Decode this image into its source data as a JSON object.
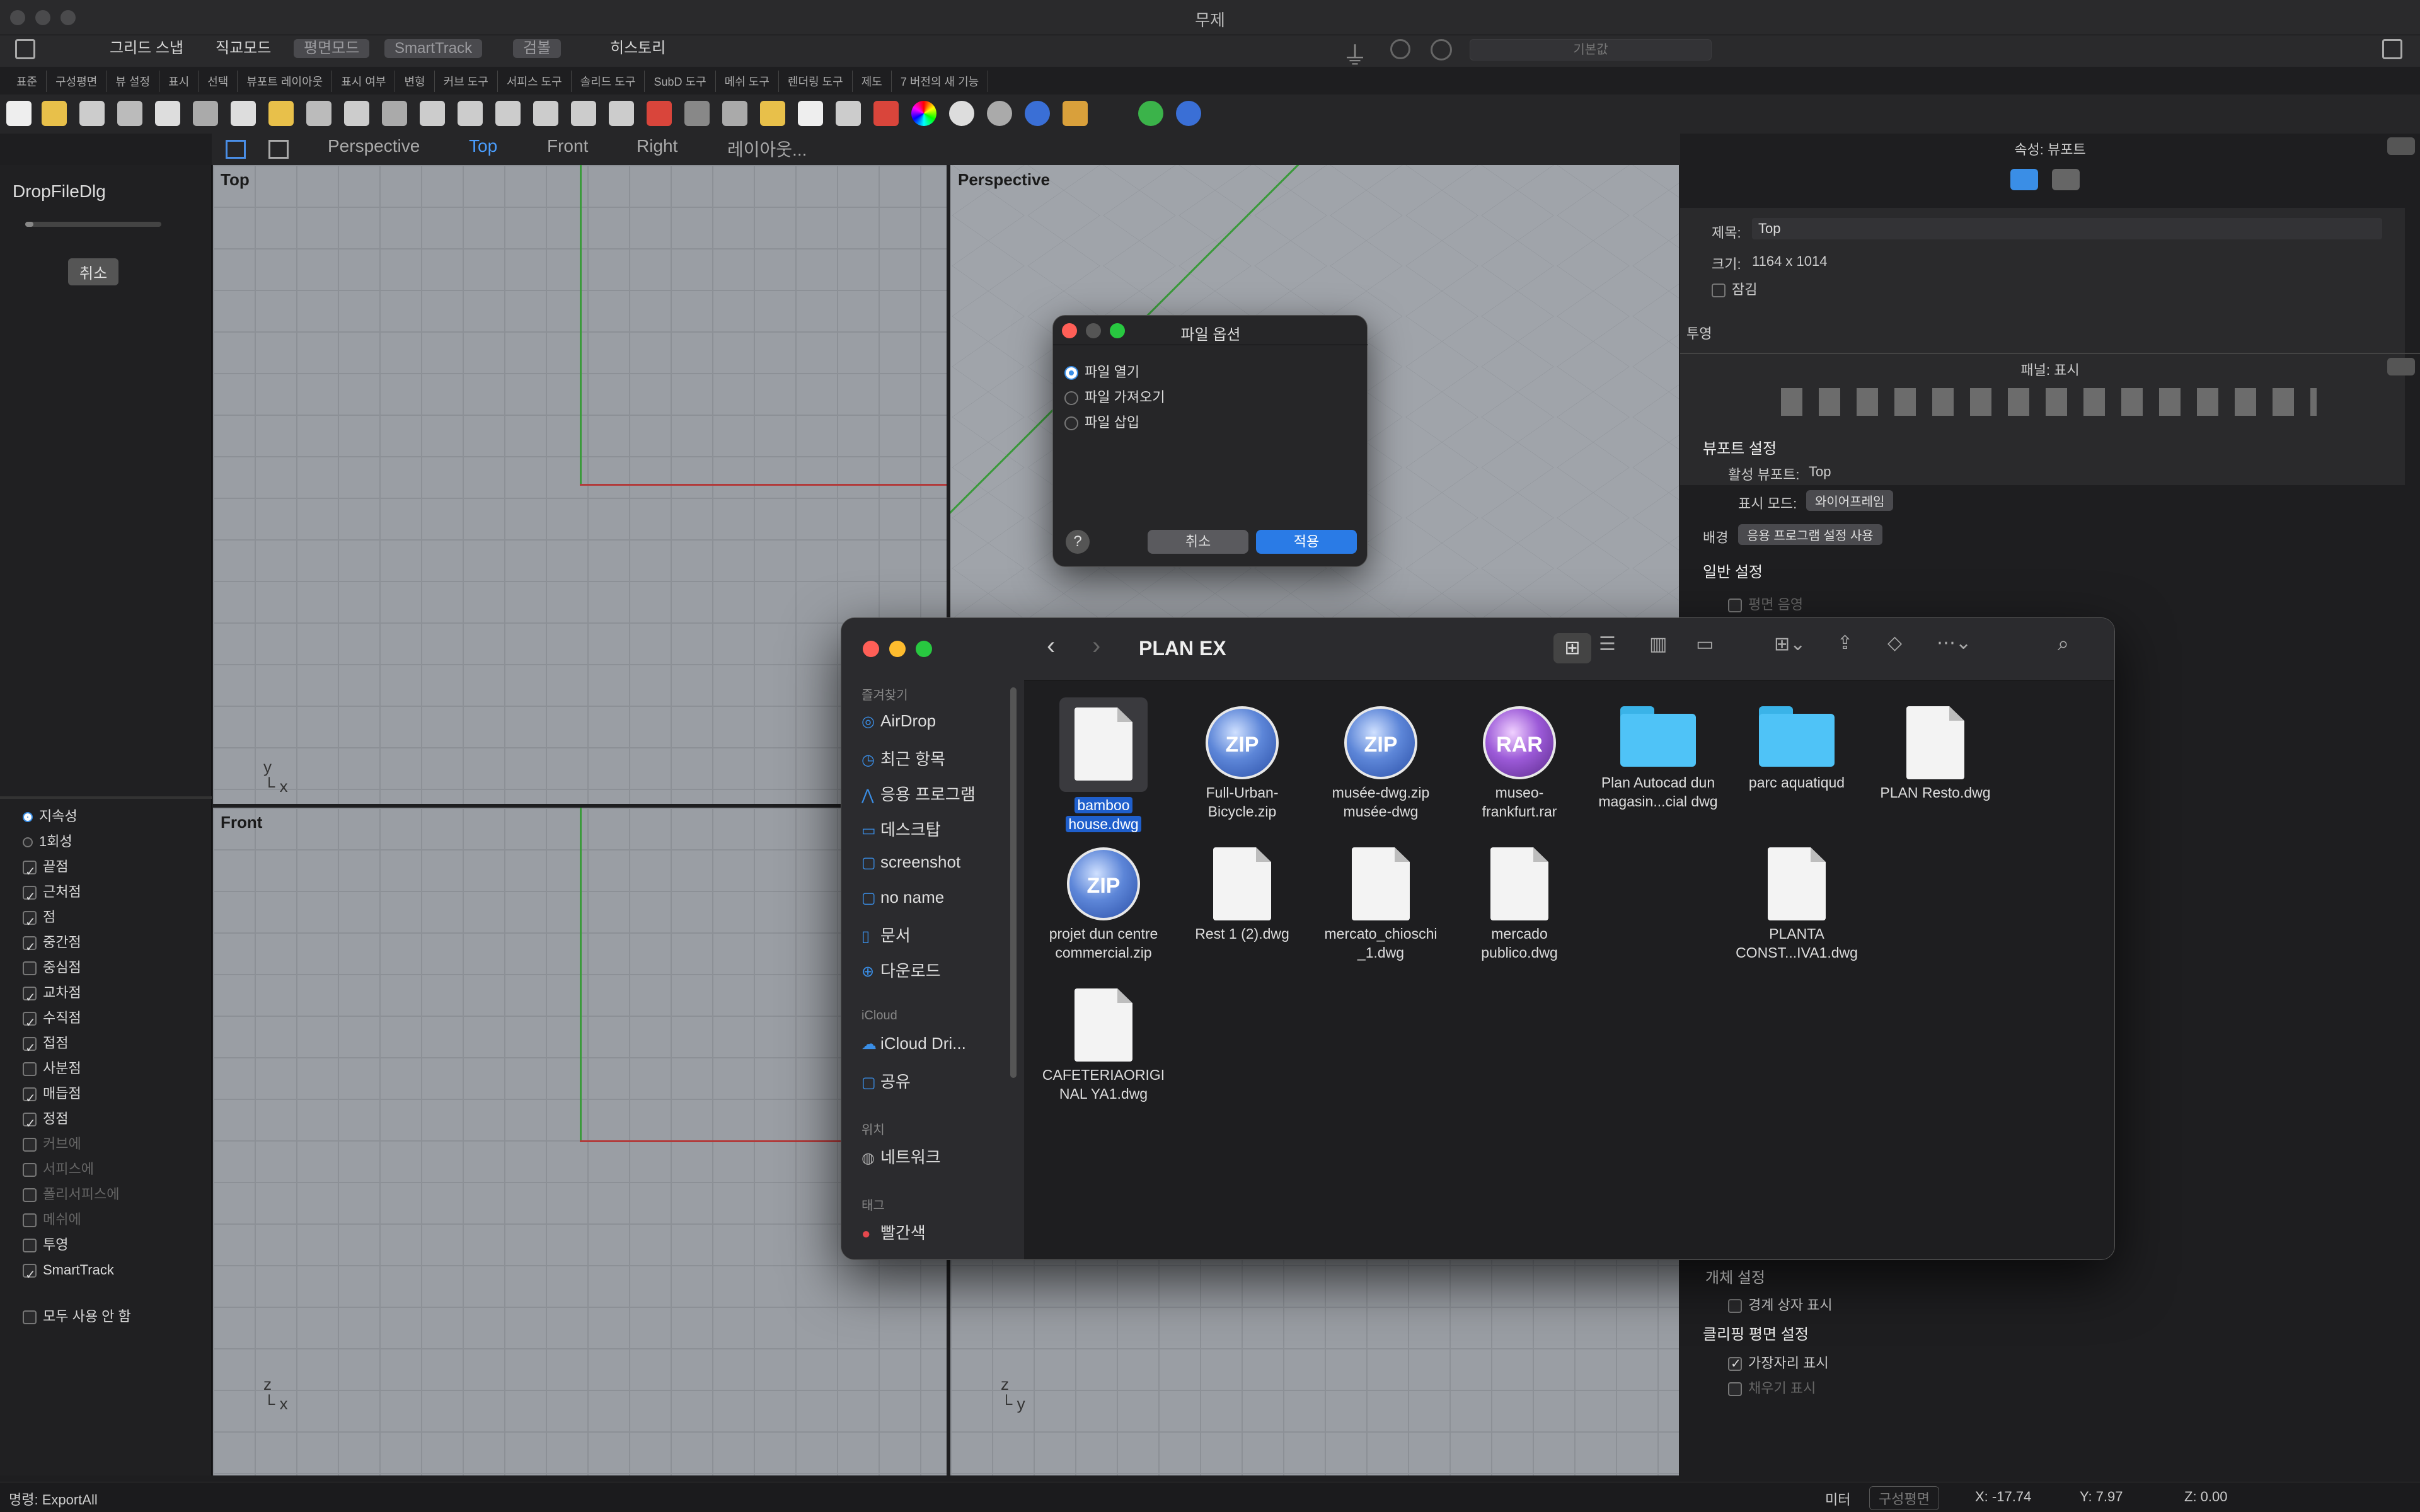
{
  "window": {
    "title": "무제"
  },
  "modebar": {
    "items": [
      "그리드 스냅",
      "직교모드",
      "평면모드",
      "SmartTrack",
      "검볼",
      "히스토리"
    ],
    "command_placeholder": "기본값"
  },
  "tabstrip": [
    "표준",
    "구성평면",
    "뷰 설정",
    "표시",
    "선택",
    "뷰포트 레이아웃",
    "표시 여부",
    "변형",
    "커브 도구",
    "서피스 도구",
    "솔리드 도구",
    "SubD 도구",
    "메쉬 도구",
    "렌더링 도구",
    "제도",
    "7 버전의 새 기능"
  ],
  "viewport_tabs": [
    "Perspective",
    "Top",
    "Front",
    "Right",
    "레이아웃..."
  ],
  "viewports": {
    "top": "Top",
    "perspective": "Perspective",
    "front": "Front"
  },
  "left_panel": {
    "dialog_title": "DropFileDlg",
    "cancel": "취소",
    "osnap_options": [
      "지속성",
      "1회성"
    ],
    "osnaps": [
      {
        "label": "끝점",
        "checked": true
      },
      {
        "label": "근처점",
        "checked": true
      },
      {
        "label": "점",
        "checked": true
      },
      {
        "label": "중간점",
        "checked": true
      },
      {
        "label": "중심점",
        "checked": false
      },
      {
        "label": "교차점",
        "checked": true
      },
      {
        "label": "수직점",
        "checked": true
      },
      {
        "label": "접점",
        "checked": true
      },
      {
        "label": "사분점",
        "checked": false
      },
      {
        "label": "매듭점",
        "checked": true
      },
      {
        "label": "정점",
        "checked": true
      },
      {
        "label": "커브에",
        "checked": false
      },
      {
        "label": "서피스에",
        "checked": false
      },
      {
        "label": "폴리서피스에",
        "checked": false
      },
      {
        "label": "메쉬에",
        "checked": false
      },
      {
        "label": "투영",
        "checked": false
      },
      {
        "label": "SmartTrack",
        "checked": true
      }
    ],
    "disable_all": "모두 사용 안 함"
  },
  "right_panel": {
    "props_title": "속성: 뷰포트",
    "title_label": "제목:",
    "title_value": "Top",
    "size_label": "크기:",
    "size_value": "1164 x 1014",
    "locked_label": "잠김",
    "projection_label": "투영",
    "panel_title": "패널: 표시",
    "viewport_settings": "뷰포트 설정",
    "active_viewport_label": "활성 뷰포트:",
    "active_viewport_value": "Top",
    "display_mode_label": "표시 모드:",
    "display_mode_value": "와이어프레임",
    "background_label": "배경",
    "background_value": "응용 프로그램 설정 사용",
    "general_settings": "일반 설정",
    "plane_shading": "평면 음영",
    "object_settings": "개체 설정",
    "show_bbox": "경계 상자 표시",
    "clipping_settings": "클리핑 평면 설정",
    "show_edges": "가장자리 표시",
    "show_fill": "채우기 표시"
  },
  "file_options": {
    "title": "파일 옵션",
    "options": [
      {
        "label": "파일 열기",
        "selected": true
      },
      {
        "label": "파일 가져오기",
        "selected": false
      },
      {
        "label": "파일 삽입",
        "selected": false
      }
    ],
    "help": "?",
    "cancel": "취소",
    "apply": "적용"
  },
  "finder": {
    "path": "PLAN EX",
    "favorites_label": "즐겨찾기",
    "favorites": [
      {
        "label": "AirDrop",
        "icon": "airdrop-icon"
      },
      {
        "label": "최근 항목",
        "icon": "clock-icon"
      },
      {
        "label": "응용 프로그램",
        "icon": "apps-icon"
      },
      {
        "label": "데스크탑",
        "icon": "desktop-icon"
      },
      {
        "label": "screenshot",
        "icon": "folder-icon"
      },
      {
        "label": "no name",
        "icon": "folder-icon"
      },
      {
        "label": "문서",
        "icon": "document-icon"
      },
      {
        "label": "다운로드",
        "icon": "download-icon"
      }
    ],
    "icloud_label": "iCloud",
    "icloud": [
      {
        "label": "iCloud Dri...",
        "icon": "cloud-icon"
      },
      {
        "label": "공유",
        "icon": "shared-folder-icon"
      }
    ],
    "locations_label": "위치",
    "locations": [
      {
        "label": "네트워크",
        "icon": "network-icon"
      }
    ],
    "tags_label": "태그",
    "tags": [
      {
        "label": "빨간색",
        "color": "#e5484d"
      }
    ],
    "files": [
      {
        "name1": "bamboo",
        "name2": "house.dwg",
        "type": "doc",
        "selected": true
      },
      {
        "name1": "Full-Urban-",
        "name2": "Bicycle.zip",
        "type": "zip"
      },
      {
        "name1": "musée-dwg.zip",
        "name2": "musée-dwg",
        "type": "zip"
      },
      {
        "name1": "museo-",
        "name2": "frankfurt.rar",
        "type": "rar"
      },
      {
        "name1": "Plan Autocad dun",
        "name2": "magasin...cial dwg",
        "type": "folder"
      },
      {
        "name1": "parc aquatiqud",
        "name2": "",
        "type": "folder"
      },
      {
        "name1": "PLAN Resto.dwg",
        "name2": "",
        "type": "doc"
      },
      {
        "name1": "projet dun centre",
        "name2": "commercial.zip",
        "type": "zip"
      },
      {
        "name1": "Rest 1 (2).dwg",
        "name2": "",
        "type": "doc"
      },
      {
        "name1": "mercato_chioschi",
        "name2": "_1.dwg",
        "type": "doc"
      },
      {
        "name1": "mercado",
        "name2": "publico.dwg",
        "type": "doc"
      },
      {
        "name1": "PLANTA",
        "name2": "CONST...IVA1.dwg",
        "type": "doc"
      },
      {
        "name1": "CAFETERIAORIGI",
        "name2": "NAL YA1.dwg",
        "type": "doc"
      }
    ]
  },
  "statusbar": {
    "command": "명령: ExportAll",
    "unit": "미터",
    "cplane": "구성평면",
    "x": "X: -17.74",
    "y": "Y: 7.97",
    "z": "Z: 0.00"
  }
}
